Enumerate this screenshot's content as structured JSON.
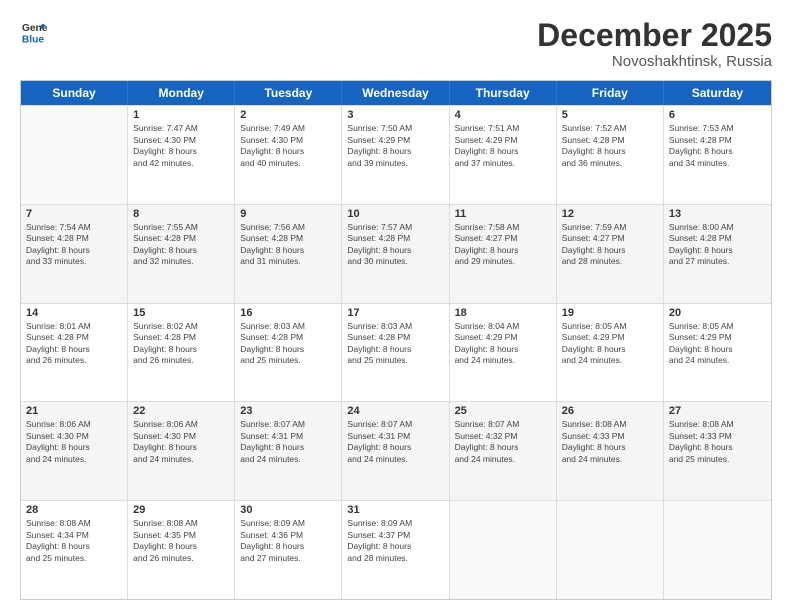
{
  "header": {
    "logo_line1": "General",
    "logo_line2": "Blue",
    "month": "December 2025",
    "location": "Novoshakhtinsk, Russia"
  },
  "weekdays": [
    "Sunday",
    "Monday",
    "Tuesday",
    "Wednesday",
    "Thursday",
    "Friday",
    "Saturday"
  ],
  "rows": [
    [
      {
        "day": "",
        "lines": [],
        "empty": true
      },
      {
        "day": "1",
        "lines": [
          "Sunrise: 7:47 AM",
          "Sunset: 4:30 PM",
          "Daylight: 8 hours",
          "and 42 minutes."
        ]
      },
      {
        "day": "2",
        "lines": [
          "Sunrise: 7:49 AM",
          "Sunset: 4:30 PM",
          "Daylight: 8 hours",
          "and 40 minutes."
        ]
      },
      {
        "day": "3",
        "lines": [
          "Sunrise: 7:50 AM",
          "Sunset: 4:29 PM",
          "Daylight: 8 hours",
          "and 39 minutes."
        ]
      },
      {
        "day": "4",
        "lines": [
          "Sunrise: 7:51 AM",
          "Sunset: 4:29 PM",
          "Daylight: 8 hours",
          "and 37 minutes."
        ]
      },
      {
        "day": "5",
        "lines": [
          "Sunrise: 7:52 AM",
          "Sunset: 4:28 PM",
          "Daylight: 8 hours",
          "and 36 minutes."
        ]
      },
      {
        "day": "6",
        "lines": [
          "Sunrise: 7:53 AM",
          "Sunset: 4:28 PM",
          "Daylight: 8 hours",
          "and 34 minutes."
        ]
      }
    ],
    [
      {
        "day": "7",
        "lines": [
          "Sunrise: 7:54 AM",
          "Sunset: 4:28 PM",
          "Daylight: 8 hours",
          "and 33 minutes."
        ]
      },
      {
        "day": "8",
        "lines": [
          "Sunrise: 7:55 AM",
          "Sunset: 4:28 PM",
          "Daylight: 8 hours",
          "and 32 minutes."
        ]
      },
      {
        "day": "9",
        "lines": [
          "Sunrise: 7:56 AM",
          "Sunset: 4:28 PM",
          "Daylight: 8 hours",
          "and 31 minutes."
        ]
      },
      {
        "day": "10",
        "lines": [
          "Sunrise: 7:57 AM",
          "Sunset: 4:28 PM",
          "Daylight: 8 hours",
          "and 30 minutes."
        ]
      },
      {
        "day": "11",
        "lines": [
          "Sunrise: 7:58 AM",
          "Sunset: 4:27 PM",
          "Daylight: 8 hours",
          "and 29 minutes."
        ]
      },
      {
        "day": "12",
        "lines": [
          "Sunrise: 7:59 AM",
          "Sunset: 4:27 PM",
          "Daylight: 8 hours",
          "and 28 minutes."
        ]
      },
      {
        "day": "13",
        "lines": [
          "Sunrise: 8:00 AM",
          "Sunset: 4:28 PM",
          "Daylight: 8 hours",
          "and 27 minutes."
        ]
      }
    ],
    [
      {
        "day": "14",
        "lines": [
          "Sunrise: 8:01 AM",
          "Sunset: 4:28 PM",
          "Daylight: 8 hours",
          "and 26 minutes."
        ]
      },
      {
        "day": "15",
        "lines": [
          "Sunrise: 8:02 AM",
          "Sunset: 4:28 PM",
          "Daylight: 8 hours",
          "and 26 minutes."
        ]
      },
      {
        "day": "16",
        "lines": [
          "Sunrise: 8:03 AM",
          "Sunset: 4:28 PM",
          "Daylight: 8 hours",
          "and 25 minutes."
        ]
      },
      {
        "day": "17",
        "lines": [
          "Sunrise: 8:03 AM",
          "Sunset: 4:28 PM",
          "Daylight: 8 hours",
          "and 25 minutes."
        ]
      },
      {
        "day": "18",
        "lines": [
          "Sunrise: 8:04 AM",
          "Sunset: 4:29 PM",
          "Daylight: 8 hours",
          "and 24 minutes."
        ]
      },
      {
        "day": "19",
        "lines": [
          "Sunrise: 8:05 AM",
          "Sunset: 4:29 PM",
          "Daylight: 8 hours",
          "and 24 minutes."
        ]
      },
      {
        "day": "20",
        "lines": [
          "Sunrise: 8:05 AM",
          "Sunset: 4:29 PM",
          "Daylight: 8 hours",
          "and 24 minutes."
        ]
      }
    ],
    [
      {
        "day": "21",
        "lines": [
          "Sunrise: 8:06 AM",
          "Sunset: 4:30 PM",
          "Daylight: 8 hours",
          "and 24 minutes."
        ]
      },
      {
        "day": "22",
        "lines": [
          "Sunrise: 8:06 AM",
          "Sunset: 4:30 PM",
          "Daylight: 8 hours",
          "and 24 minutes."
        ]
      },
      {
        "day": "23",
        "lines": [
          "Sunrise: 8:07 AM",
          "Sunset: 4:31 PM",
          "Daylight: 8 hours",
          "and 24 minutes."
        ]
      },
      {
        "day": "24",
        "lines": [
          "Sunrise: 8:07 AM",
          "Sunset: 4:31 PM",
          "Daylight: 8 hours",
          "and 24 minutes."
        ]
      },
      {
        "day": "25",
        "lines": [
          "Sunrise: 8:07 AM",
          "Sunset: 4:32 PM",
          "Daylight: 8 hours",
          "and 24 minutes."
        ]
      },
      {
        "day": "26",
        "lines": [
          "Sunrise: 8:08 AM",
          "Sunset: 4:33 PM",
          "Daylight: 8 hours",
          "and 24 minutes."
        ]
      },
      {
        "day": "27",
        "lines": [
          "Sunrise: 8:08 AM",
          "Sunset: 4:33 PM",
          "Daylight: 8 hours",
          "and 25 minutes."
        ]
      }
    ],
    [
      {
        "day": "28",
        "lines": [
          "Sunrise: 8:08 AM",
          "Sunset: 4:34 PM",
          "Daylight: 8 hours",
          "and 25 minutes."
        ]
      },
      {
        "day": "29",
        "lines": [
          "Sunrise: 8:08 AM",
          "Sunset: 4:35 PM",
          "Daylight: 8 hours",
          "and 26 minutes."
        ]
      },
      {
        "day": "30",
        "lines": [
          "Sunrise: 8:09 AM",
          "Sunset: 4:36 PM",
          "Daylight: 8 hours",
          "and 27 minutes."
        ]
      },
      {
        "day": "31",
        "lines": [
          "Sunrise: 8:09 AM",
          "Sunset: 4:37 PM",
          "Daylight: 8 hours",
          "and 28 minutes."
        ]
      },
      {
        "day": "",
        "lines": [],
        "empty": true
      },
      {
        "day": "",
        "lines": [],
        "empty": true
      },
      {
        "day": "",
        "lines": [],
        "empty": true
      }
    ]
  ]
}
